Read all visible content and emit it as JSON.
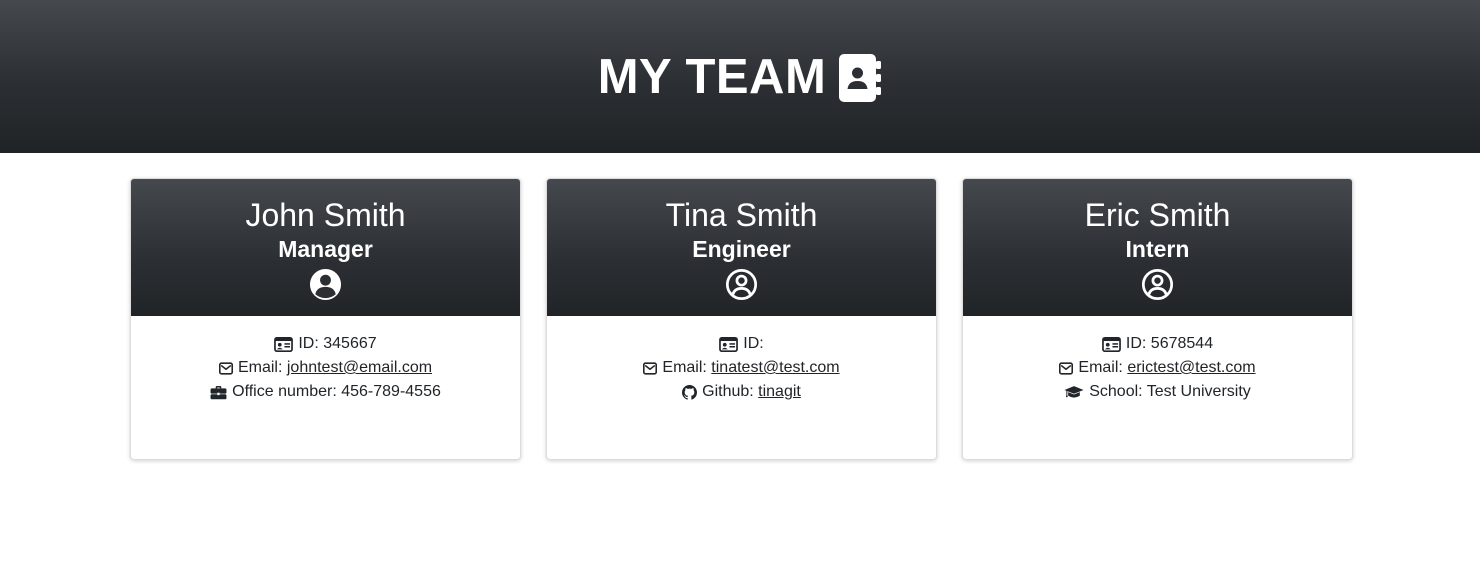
{
  "header": {
    "title": "MY TEAM",
    "icon": "address-book-icon",
    "background": "#2b2f33"
  },
  "cards": [
    {
      "name": "John Smith",
      "role": "Manager",
      "role_icon": "user-circle-solid-icon",
      "id_label": "ID: ",
      "id_value": "345667",
      "email_label": "Email: ",
      "email": "johntest@email.com",
      "extra_icon": "briefcase-icon",
      "extra_label": "Office number: ",
      "extra_value": "456-789-4556"
    },
    {
      "name": "Tina Smith",
      "role": "Engineer",
      "role_icon": "user-circle-outline-icon",
      "id_label": "ID:",
      "id_value": "",
      "email_label": "Email: ",
      "email": "tinatest@test.com",
      "extra_icon": "github-icon",
      "extra_label": "Github: ",
      "extra_value": "tinagit"
    },
    {
      "name": "Eric Smith",
      "role": "Intern",
      "role_icon": "user-circle-outline-icon",
      "id_label": "ID: ",
      "id_value": "5678544",
      "email_label": "Email: ",
      "email": "erictest@test.com",
      "extra_icon": "graduation-cap-icon",
      "extra_label": "School: ",
      "extra_value": "Test University"
    }
  ]
}
